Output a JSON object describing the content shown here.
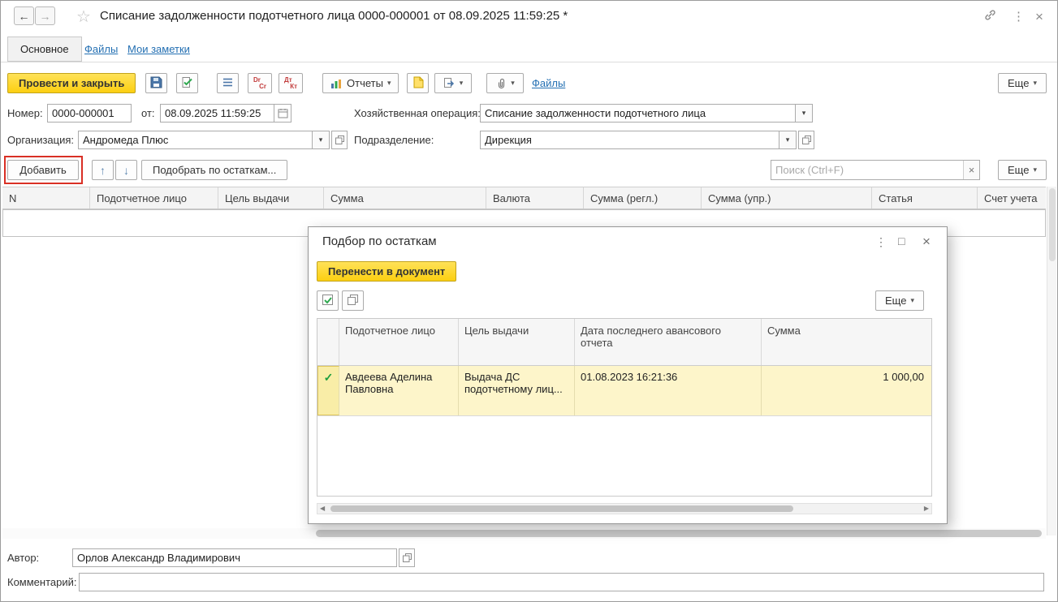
{
  "window": {
    "title": "Списание задолженности подотчетного лица 0000-000001 от 08.09.2025 11:59:25 *"
  },
  "nav_tabs": {
    "main": "Основное",
    "files": "Файлы",
    "notes": "Мои заметки"
  },
  "toolbar": {
    "post_and_close": "Провести и закрыть",
    "reports": "Отчеты",
    "files_link": "Файлы",
    "more": "Еще"
  },
  "header_fields": {
    "number_label": "Номер:",
    "number_value": "0000-000001",
    "date_label": "от:",
    "date_value": "08.09.2025 11:59:25",
    "operation_label": "Хозяйственная операция:",
    "operation_value": "Списание задолженности подотчетного лица",
    "organization_label": "Организация:",
    "organization_value": "Андромеда Плюс",
    "department_label": "Подразделение:",
    "department_value": "Дирекция"
  },
  "table_toolbar": {
    "add": "Добавить",
    "pick_by_balance": "Подобрать по остаткам...",
    "search_placeholder": "Поиск (Ctrl+F)",
    "more": "Еще"
  },
  "main_table": {
    "columns": [
      "N",
      "Подотчетное лицо",
      "Цель выдачи",
      "Сумма",
      "Валюта",
      "Сумма (регл.)",
      "Сумма (упр.)",
      "Статья",
      "Счет учета"
    ]
  },
  "dialog": {
    "title": "Подбор по остаткам",
    "transfer_button": "Перенести в документ",
    "more": "Еще",
    "columns": [
      "Подотчетное лицо",
      "Цель выдачи",
      "Дата последнего авансового отчета",
      "Сумма"
    ],
    "row": {
      "person": "Авдеева Аделина Павловна",
      "purpose": "Выдача ДС подотчетному лиц...",
      "last_report_date": "01.08.2023 16:21:36",
      "amount": "1 000,00"
    }
  },
  "footer": {
    "author_label": "Автор:",
    "author_value": "Орлов Александр Владимирович",
    "comment_label": "Комментарий:",
    "comment_value": ""
  },
  "icons": {
    "back": "←",
    "forward": "→",
    "star": "☆",
    "dots": "⋮",
    "close": "×",
    "dropdown": "▾",
    "up": "↑",
    "down": "↓",
    "clear": "×",
    "check": "✓",
    "maximize": "□",
    "scroll_left": "◀",
    "scroll_right": "▶",
    "dr": "Dr",
    "cr": "Cr",
    "dt": "Дт",
    "kt": "Кт"
  },
  "colors": {
    "accent_yellow": "#fccf11",
    "link_blue": "#2470b3",
    "selection_yellow": "#fdf5ca",
    "annotation_red": "#d93025"
  }
}
